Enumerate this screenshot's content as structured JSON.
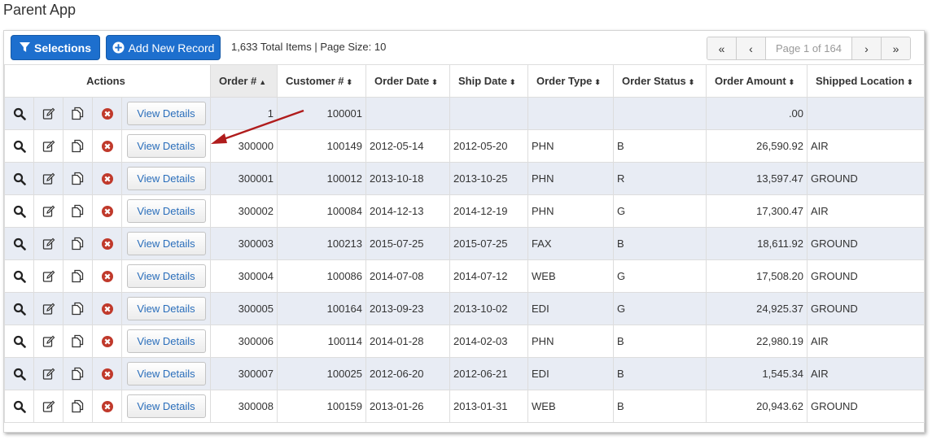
{
  "app_title": "Parent App",
  "toolbar": {
    "selections_label": "Selections",
    "add_label": "Add New Record",
    "total_items": "1,633 Total Items | Page Size: 10"
  },
  "pager": {
    "first": "«",
    "prev": "‹",
    "info": "Page 1 of 164",
    "next": "›",
    "last": "»"
  },
  "columns": {
    "actions": "Actions",
    "order_num": "Order #",
    "customer_num": "Customer #",
    "order_date": "Order Date",
    "ship_date": "Ship Date",
    "order_type": "Order Type",
    "order_status": "Order Status",
    "order_amount": "Order Amount",
    "shipped_location": "Shipped Location"
  },
  "sort": {
    "column": "order_num",
    "direction": "ascending"
  },
  "view_details_label": "View Details",
  "rows": [
    {
      "order": "1",
      "customer": "100001",
      "order_date": "",
      "ship_date": "",
      "type": "",
      "status": "",
      "amount": ".00",
      "location": ""
    },
    {
      "order": "300000",
      "customer": "100149",
      "order_date": "2012-05-14",
      "ship_date": "2012-05-20",
      "type": "PHN",
      "status": "B",
      "amount": "26,590.92",
      "location": "AIR"
    },
    {
      "order": "300001",
      "customer": "100012",
      "order_date": "2013-10-18",
      "ship_date": "2013-10-25",
      "type": "PHN",
      "status": "R",
      "amount": "13,597.47",
      "location": "GROUND"
    },
    {
      "order": "300002",
      "customer": "100084",
      "order_date": "2014-12-13",
      "ship_date": "2014-12-19",
      "type": "PHN",
      "status": "G",
      "amount": "17,300.47",
      "location": "AIR"
    },
    {
      "order": "300003",
      "customer": "100213",
      "order_date": "2015-07-25",
      "ship_date": "2015-07-25",
      "type": "FAX",
      "status": "B",
      "amount": "18,611.92",
      "location": "GROUND"
    },
    {
      "order": "300004",
      "customer": "100086",
      "order_date": "2014-07-08",
      "ship_date": "2014-07-12",
      "type": "WEB",
      "status": "G",
      "amount": "17,508.20",
      "location": "GROUND"
    },
    {
      "order": "300005",
      "customer": "100164",
      "order_date": "2013-09-23",
      "ship_date": "2013-10-02",
      "type": "EDI",
      "status": "G",
      "amount": "24,925.37",
      "location": "GROUND"
    },
    {
      "order": "300006",
      "customer": "100114",
      "order_date": "2014-01-28",
      "ship_date": "2014-02-03",
      "type": "PHN",
      "status": "B",
      "amount": "22,980.19",
      "location": "AIR"
    },
    {
      "order": "300007",
      "customer": "100025",
      "order_date": "2012-06-20",
      "ship_date": "2012-06-21",
      "type": "EDI",
      "status": "B",
      "amount": "1,545.34",
      "location": "AIR"
    },
    {
      "order": "300008",
      "customer": "100159",
      "order_date": "2013-01-26",
      "ship_date": "2013-01-31",
      "type": "WEB",
      "status": "B",
      "amount": "20,943.62",
      "location": "GROUND"
    }
  ],
  "row_icons": [
    "search-icon",
    "edit-icon",
    "copy-icon",
    "delete-icon"
  ],
  "colors": {
    "primary_button": "#1d6fce",
    "odd_row": "#e8ecf4",
    "delete_icon": "#c0392b",
    "annotation_arrow": "#b01c1c"
  }
}
